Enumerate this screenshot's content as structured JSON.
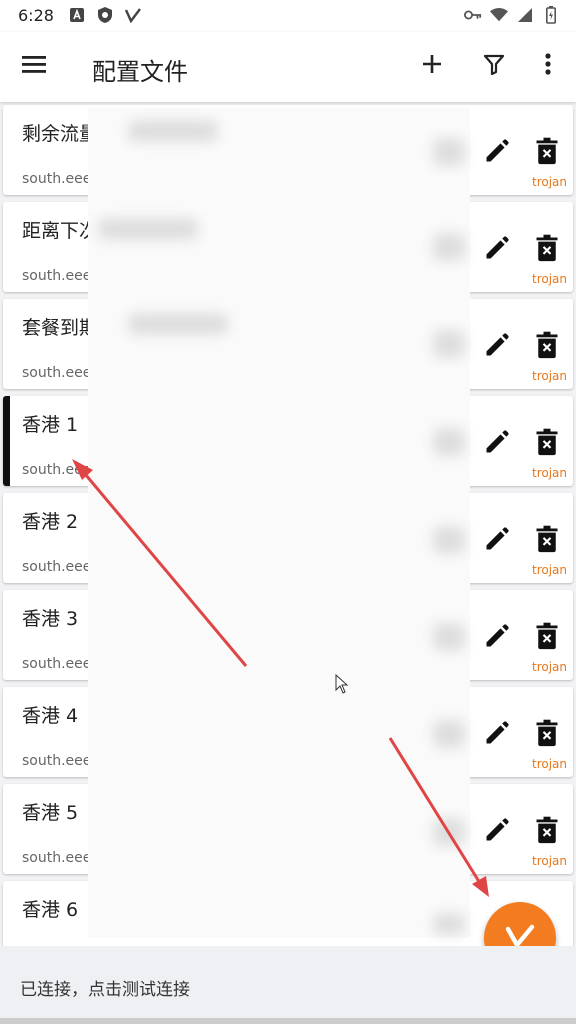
{
  "status_bar": {
    "time": "6:28",
    "left_icons": [
      "a-badge-icon",
      "shield-icon",
      "v2-icon"
    ],
    "right_icons": [
      "key-icon",
      "wifi-icon",
      "signal-icon",
      "battery-icon"
    ]
  },
  "app_bar": {
    "title": "配置文件",
    "actions": [
      "plus-icon",
      "filter-icon",
      "more-vert-icon"
    ]
  },
  "profiles": [
    {
      "name": "剩余流量",
      "address": "south.eee",
      "type": "trojan"
    },
    {
      "name": "距离下次",
      "address": "south.eee",
      "type": "trojan"
    },
    {
      "name": "套餐到期",
      "address": "south.eee",
      "type": "trojan"
    },
    {
      "name": "香港 1",
      "address": "south.eee",
      "type": "trojan",
      "selected": true
    },
    {
      "name": "香港 2",
      "address": "south.eee",
      "type": "trojan"
    },
    {
      "name": "香港 3",
      "address": "south.eee",
      "type": "trojan"
    },
    {
      "name": "香港 4",
      "address": "south.eee",
      "type": "trojan"
    },
    {
      "name": "香港 5",
      "address": "south.eee",
      "type": "trojan"
    },
    {
      "name": "香港 6",
      "address": "",
      "type": ""
    }
  ],
  "bottom_bar": {
    "status": "已连接，点击测试连接"
  },
  "colors": {
    "accent": "#f47c20",
    "type_label": "#e8771b",
    "annotation_arrow": "#e04545"
  }
}
